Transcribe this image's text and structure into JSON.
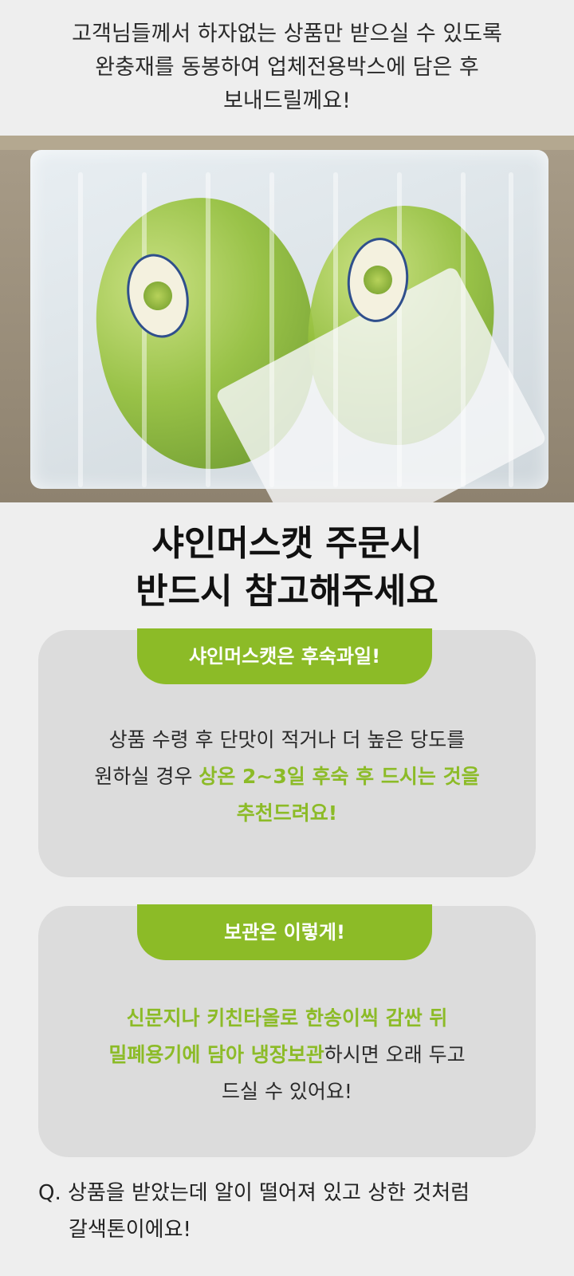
{
  "intro": {
    "lines": [
      "고객님들께서 하자없는 상품만 받으실 수 있도록",
      "완충재를 동봉하여 업체전용박스에 담은 후",
      "보내드릴께요!"
    ]
  },
  "photo": {
    "subject": "packed-grape-box"
  },
  "heading": {
    "line1": "샤인머스캣 주문시",
    "line2": "반드시 참고해주세요"
  },
  "card1": {
    "tag": "샤인머스캣은 후숙과일!",
    "line1": "상품 수령 후 단맛이 적거나 더 높은 당도를",
    "line2_plain": "원하실 경우 ",
    "line2_highlight": "상온 2~3일 후숙 후 드시는 것을",
    "line3_highlight": "추천드려요!"
  },
  "card2": {
    "tag": "보관은 이렇게!",
    "line1_highlight": "신문지나 키친타올로 한송이씩 감싼 뒤",
    "line2_highlight": "밀폐용기에 담아 냉장보관",
    "line2_plain": "하시면 오래 두고",
    "line3": "드실 수 있어요!"
  },
  "faq": {
    "q_line1": "Q. 상품을 받았는데 알이 떨어져 있고 상한 것처럼",
    "q_line2": "갈색톤이에요!"
  },
  "colors": {
    "accent": "#8cbb27",
    "card_bg": "#dcdcdc",
    "page_bg": "#eeeeee"
  }
}
